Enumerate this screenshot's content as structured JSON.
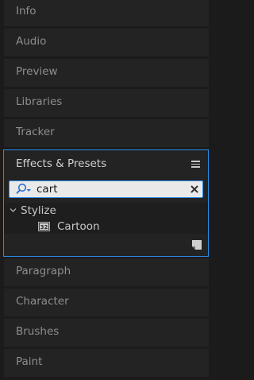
{
  "panels_above": [
    {
      "label": "Info"
    },
    {
      "label": "Audio"
    },
    {
      "label": "Preview"
    },
    {
      "label": "Libraries"
    },
    {
      "label": "Tracker"
    }
  ],
  "effects_panel": {
    "title": "Effects & Presets",
    "menu_icon": "hamburger-menu-icon",
    "search": {
      "value": "cart",
      "search_icon": "magnifier-dropdown-icon",
      "clear_icon": "close-icon"
    },
    "results": {
      "folder": {
        "label": "Stylize",
        "expanded": true
      },
      "items": [
        {
          "label": "Cartoon",
          "icon": "effect-32bit-icon",
          "badge": "32"
        }
      ]
    },
    "footer_icon": "new-bin-icon",
    "accent_color": "#2d8ceb"
  },
  "panels_below": [
    {
      "label": "Paragraph"
    },
    {
      "label": "Character"
    },
    {
      "label": "Brushes"
    },
    {
      "label": "Paint"
    }
  ]
}
